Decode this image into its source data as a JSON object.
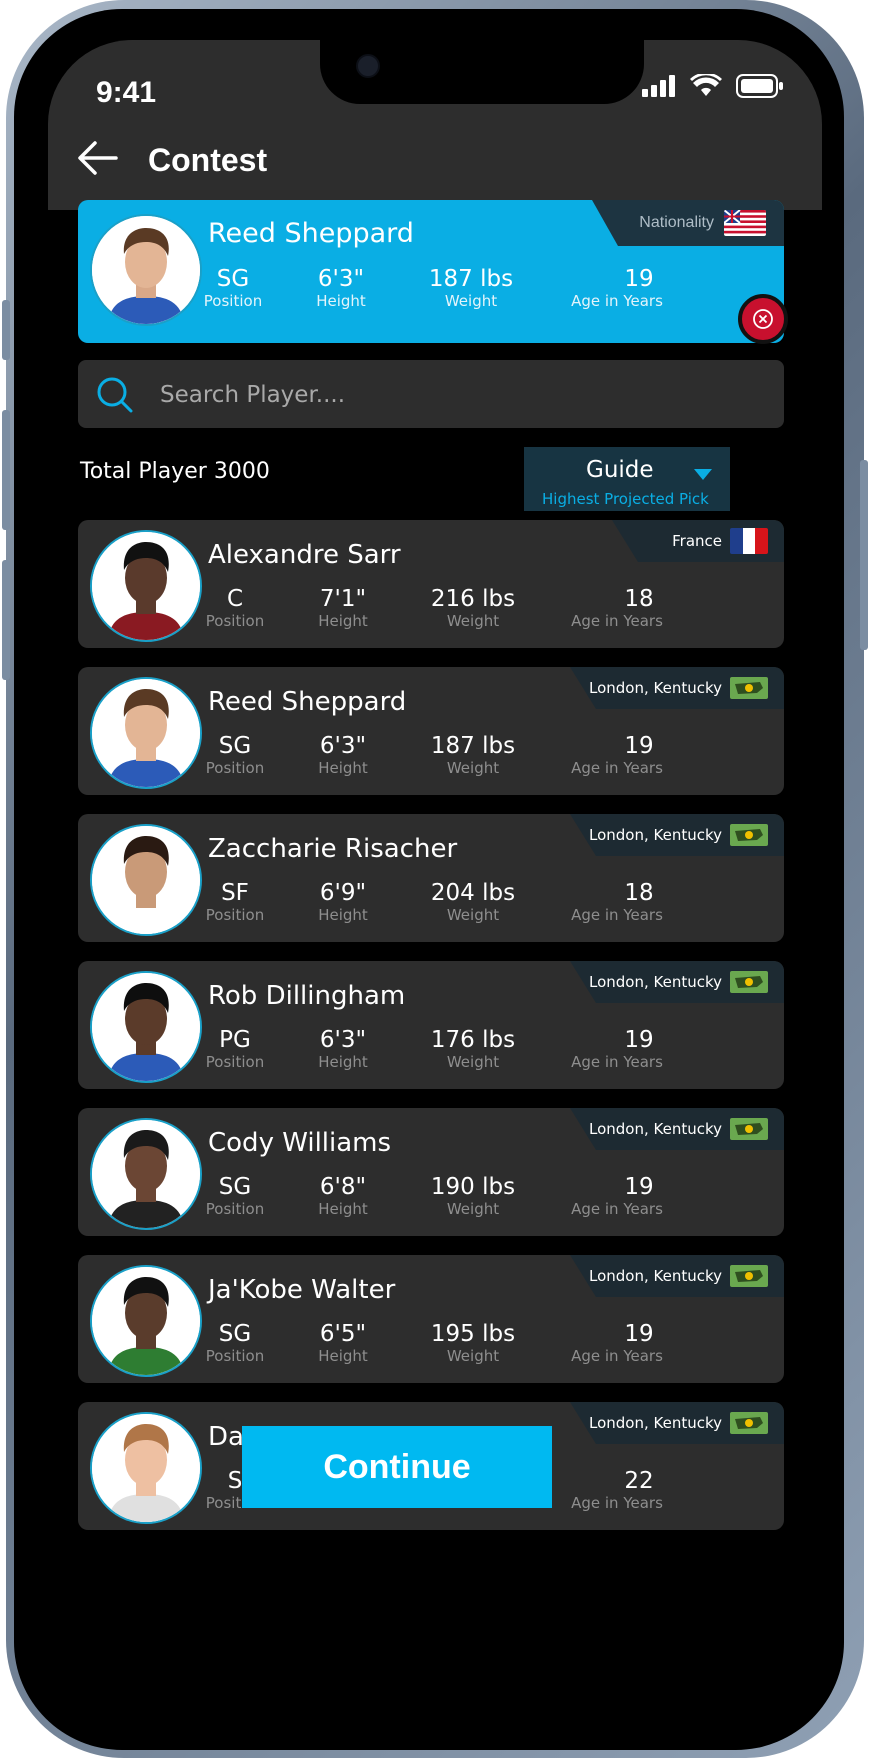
{
  "status_bar": {
    "time": "9:41"
  },
  "header": {
    "title": "Contest"
  },
  "selected_player": {
    "name": "Reed Sheppard",
    "nationality_label": "Nationality",
    "position": "SG",
    "position_label": "Position",
    "height": "6'3\"",
    "height_label": "Height",
    "weight": "187 lbs",
    "weight_label": "Weight",
    "age": "19",
    "age_label": "Age in Years"
  },
  "search": {
    "placeholder": "Search Player...."
  },
  "total_players": "Total Player 3000",
  "guide": {
    "label": "Guide",
    "subtitle": "Highest Projected Pick"
  },
  "players": [
    {
      "name": "Alexandre Sarr",
      "location": "France",
      "position": "C",
      "height": "7'1\"",
      "weight": "216 lbs",
      "age": "18",
      "flag": "france"
    },
    {
      "name": "Reed Sheppard",
      "location": "London, Kentucky",
      "position": "SG",
      "height": "6'3\"",
      "weight": "187 lbs",
      "age": "19",
      "flag": "kentucky"
    },
    {
      "name": "Zaccharie Risacher",
      "location": "London, Kentucky",
      "position": "SF",
      "height": "6'9\"",
      "weight": "204 lbs",
      "age": "18",
      "flag": "kentucky"
    },
    {
      "name": "Rob Dillingham",
      "location": "London, Kentucky",
      "position": "PG",
      "height": "6'3\"",
      "weight": "176 lbs",
      "age": "19",
      "flag": "kentucky"
    },
    {
      "name": "Cody Williams",
      "location": "London, Kentucky",
      "position": "SG",
      "height": "6'8\"",
      "weight": "190 lbs",
      "age": "19",
      "flag": "kentucky"
    },
    {
      "name": "Ja'Kobe Walter",
      "location": "London, Kentucky",
      "position": "SG",
      "height": "6'5\"",
      "weight": "195 lbs",
      "age": "19",
      "flag": "kentucky"
    },
    {
      "name": "Da",
      "location": "London, Kentucky",
      "position": "S",
      "height": "",
      "weight": "",
      "age": "22",
      "flag": "kentucky"
    }
  ],
  "stat_labels": {
    "position": "Position",
    "height": "Height",
    "weight": "Weight",
    "age": "Age in Years"
  },
  "continue_button": "Continue",
  "colors": {
    "accent": "#0aaee4",
    "card_bg": "#2d2d2d",
    "background": "#000000",
    "close_red": "#c8102e"
  }
}
